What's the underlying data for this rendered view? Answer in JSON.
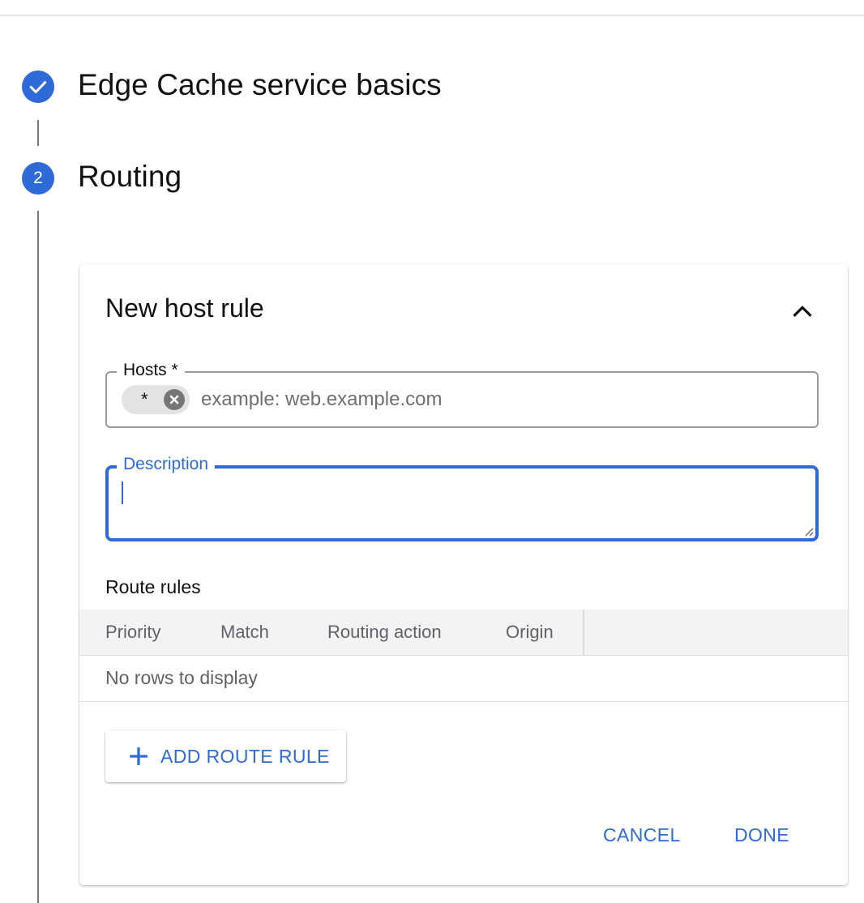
{
  "colors": {
    "accent": "#2f6bd8",
    "step_line": "#7a7a7a",
    "chip_bg": "#e3e3e3",
    "table_header_bg": "#f3f3f3"
  },
  "stepper": {
    "steps": [
      {
        "icon": "check-icon",
        "title": "Edge Cache service basics",
        "state": "completed"
      },
      {
        "number": "2",
        "title": "Routing",
        "state": "active"
      }
    ]
  },
  "card": {
    "title": "New host rule",
    "collapse_icon": "chevron-up-icon",
    "hosts": {
      "label": "Hosts *",
      "chips": [
        "*"
      ],
      "chip_remove_icon": "cancel-circle-icon",
      "placeholder": "example: web.example.com",
      "value": ""
    },
    "description": {
      "label": "Description",
      "value": "",
      "focused": true
    },
    "route_rules": {
      "label": "Route rules",
      "columns": [
        "Priority",
        "Match",
        "Routing action",
        "Origin"
      ],
      "rows": [],
      "empty_text": "No rows to display"
    },
    "add_route_rule": {
      "icon": "plus-icon",
      "label": "ADD ROUTE RULE"
    },
    "actions": {
      "cancel_label": "CANCEL",
      "done_label": "DONE"
    }
  }
}
